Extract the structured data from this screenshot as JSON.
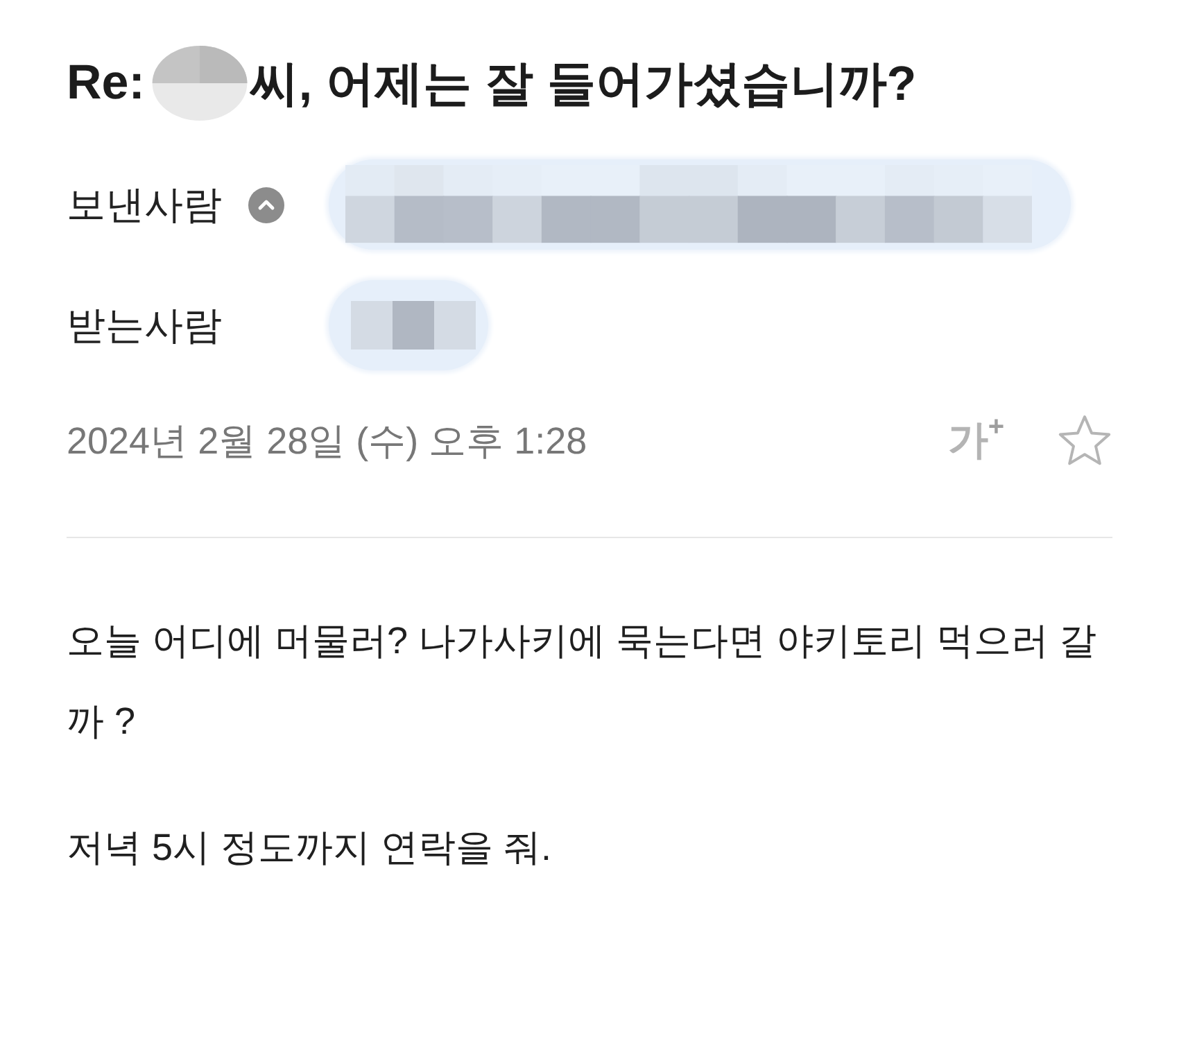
{
  "header": {
    "subject_prefix": "Re:",
    "subject_text": "씨, 어제는 잘 들어가셨습니까?"
  },
  "sender": {
    "label": "보낸사람",
    "expanded": true
  },
  "recipient": {
    "label": "받는사람"
  },
  "meta": {
    "date": "2024년 2월 28일 (수) 오후 1:28",
    "text_size_button": "가$^{+}$",
    "starred": false
  },
  "body": {
    "paragraphs": [
      "오늘 어디에 머물러? 나가사키에 묵는다면 야키토리 먹으러 갈까 ?",
      "저녁 5시 정도까지 연락을 줘."
    ]
  }
}
